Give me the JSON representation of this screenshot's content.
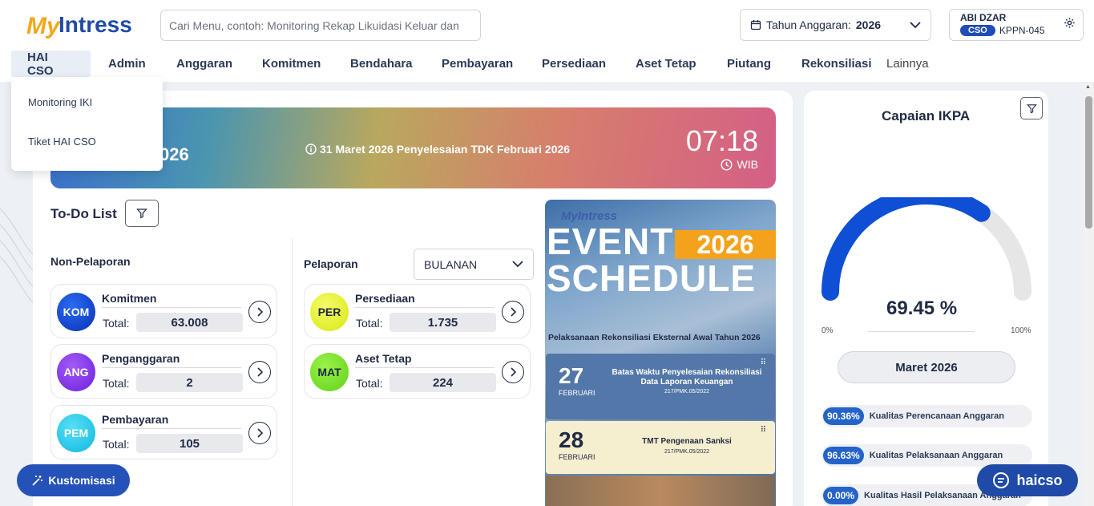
{
  "brand": {
    "logo_text_my": "My",
    "logo_text_intress": "Intress"
  },
  "search": {
    "placeholder": "Cari Menu, contoh: Monitoring Rekap Likuidasi Keluar dan"
  },
  "tahun": {
    "label": "Tahun Anggaran:",
    "value": "2026"
  },
  "user": {
    "name": "ABI DZAR",
    "role": "CSO",
    "office": "KPPN-045"
  },
  "nav": [
    {
      "label": "HAI CSO"
    },
    {
      "label": "Admin"
    },
    {
      "label": "Anggaran"
    },
    {
      "label": "Komitmen"
    },
    {
      "label": "Bendahara"
    },
    {
      "label": "Pembayaran"
    },
    {
      "label": "Persediaan"
    },
    {
      "label": "Aset Tetap"
    },
    {
      "label": "Piutang"
    },
    {
      "label": "Rekonsiliasi"
    },
    {
      "label": "Lainnya"
    }
  ],
  "dropdown": [
    {
      "label": "Monitoring IKI"
    },
    {
      "label": "Tiket HAI CSO"
    }
  ],
  "banner": {
    "year_fragment": "026",
    "message": "31 Maret 2026 Penyelesaian TDK Februari 2026",
    "time": "07:18",
    "timezone": "WIB"
  },
  "todo": {
    "title": "To-Do List",
    "non_pelaporan_label": "Non-Pelaporan",
    "pelaporan_label": "Pelaporan",
    "period_select": "BULANAN",
    "total_label": "Total:",
    "non_pelaporan": [
      {
        "code": "KOM",
        "title": "Komitmen",
        "total": "63.008"
      },
      {
        "code": "ANG",
        "title": "Penganggaran",
        "total": "2"
      },
      {
        "code": "PEM",
        "title": "Pembayaran",
        "total": "105"
      }
    ],
    "pelaporan": [
      {
        "code": "PER",
        "title": "Persediaan",
        "total": "1.735"
      },
      {
        "code": "MAT",
        "title": "Aset Tetap",
        "total": "224"
      }
    ]
  },
  "poster": {
    "logo": "MyIntress",
    "word1": "EVENT",
    "year": "2026",
    "word2": "SCHEDULE",
    "subtitle": "Pelaksanaan Rekonsiliasi Eksternal Awal Tahun 2026",
    "events": [
      {
        "day": "27",
        "month": "FEBRUARI",
        "text": "Batas Waktu Penyelesaian Rekonsiliasi Data Laporan Keuangan",
        "ref": "217/PMK.05/2022"
      },
      {
        "day": "28",
        "month": "FEBRUARI",
        "text": "TMT Pengenaan Sanksi",
        "ref": "217/PMK.05/2022"
      }
    ]
  },
  "ikpa": {
    "title": "Capaian IKPA",
    "value_text": "69.45 %",
    "value": 69.45,
    "min_label": "0%",
    "max_label": "100%",
    "month": "Maret 2026",
    "metrics": [
      {
        "pct": "90.36%",
        "label": "Kualitas Perencanaan Anggaran"
      },
      {
        "pct": "96.63%",
        "label": "Kualitas Pelaksanaan Anggaran"
      },
      {
        "pct": "0.00%",
        "label": "Kualitas Hasil Pelaksanaan Anggaran"
      }
    ],
    "colors": {
      "fill": "#0f4fd6",
      "track": "#e6e6e6"
    }
  },
  "buttons": {
    "kustomisasi": "Kustomisasi",
    "haicso": "haicso"
  }
}
